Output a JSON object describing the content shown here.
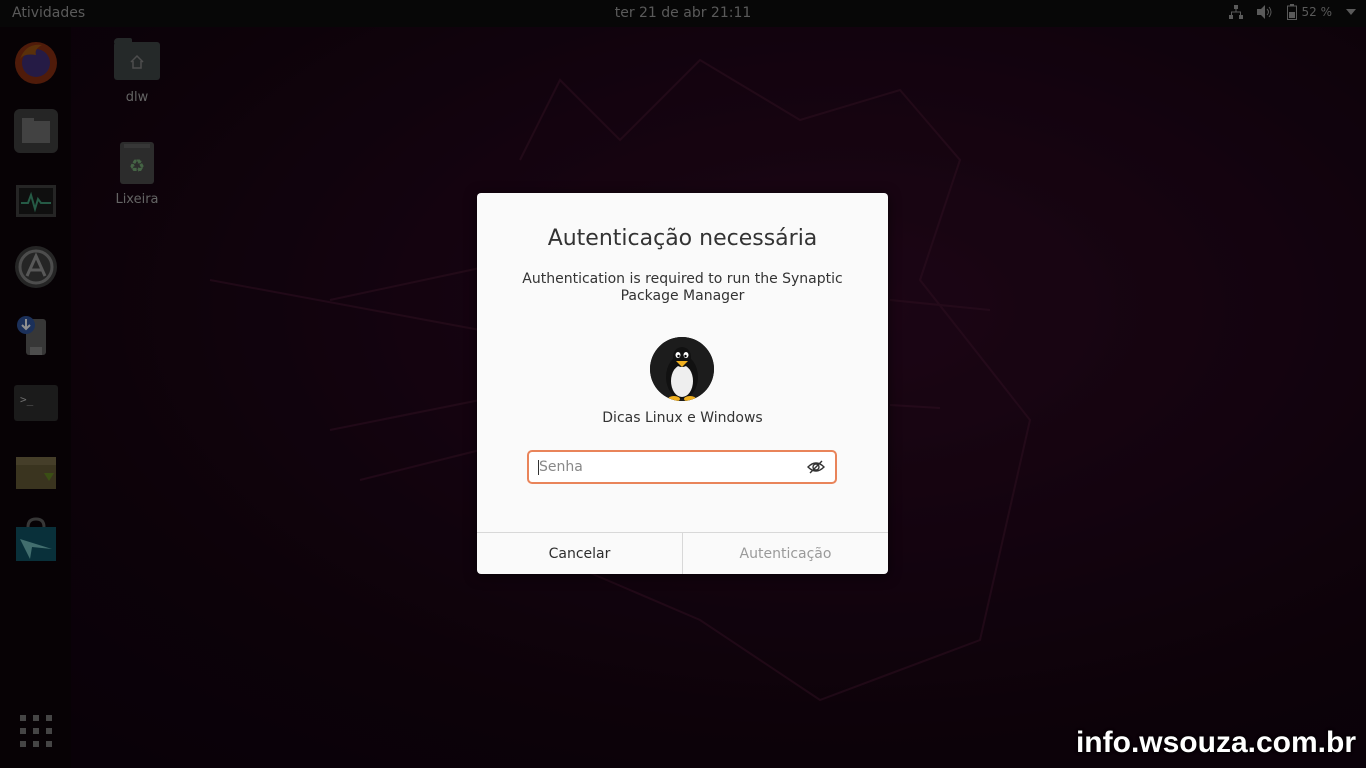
{
  "topbar": {
    "activities": "Atividades",
    "clock": "ter 21 de abr  21:11",
    "battery": "52 %",
    "icons": [
      "network-icon",
      "volume-icon",
      "battery-icon"
    ]
  },
  "dock": {
    "items": [
      "firefox-icon",
      "files-icon",
      "system-monitor-icon",
      "software-center-icon",
      "usb-creator-icon",
      "terminal-icon",
      "archive-manager-icon",
      "synaptic-icon",
      "show-apps-icon"
    ]
  },
  "desktop": {
    "icons": [
      {
        "label": "dlw",
        "icon": "home-folder-icon"
      },
      {
        "label": "Lixeira",
        "icon": "trash-icon"
      }
    ]
  },
  "dialog": {
    "title": "Autenticação necessária",
    "message": "Authentication is required to run the Synaptic Package Manager",
    "user": "Dicas Linux e Windows",
    "password": {
      "value": "",
      "placeholder": "Senha"
    },
    "cancel_label": "Cancelar",
    "auth_label": "Autenticação"
  },
  "watermark": "info.wsouza.com.br",
  "colors": {
    "accent": "#e9845a",
    "dialog_bg": "#fafafa",
    "topbar_bg": "#0b0b0b"
  }
}
